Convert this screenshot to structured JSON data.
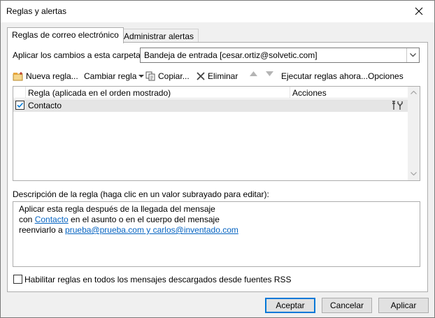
{
  "window": {
    "title": "Reglas y alertas"
  },
  "tabs": [
    {
      "label": "Reglas de correo electrónico",
      "active": true
    },
    {
      "label": "Administrar alertas",
      "active": false
    }
  ],
  "folder": {
    "label": "Aplicar los cambios a esta carpeta:",
    "value": "Bandeja de entrada [cesar.ortiz@solvetic.com]"
  },
  "toolbar": {
    "new_rule": "Nueva regla...",
    "change_rule": "Cambiar regla",
    "copy": "Copiar...",
    "delete": "Eliminar",
    "run_rules": "Ejecutar reglas ahora...",
    "options": "Opciones"
  },
  "rules_table": {
    "columns": [
      "Regla (aplicada en el orden mostrado)",
      "Acciones"
    ],
    "rows": [
      {
        "checked": true,
        "name": "Contacto",
        "action_icon": "forward-action-icon"
      }
    ]
  },
  "description": {
    "label": "Descripción de la regla (haga clic en un valor subrayado para editar):",
    "line1": "Aplicar esta regla después de la llegada del mensaje",
    "line2_prefix": "con ",
    "line2_link": "Contacto",
    "line2_suffix": " en el asunto o en el cuerpo del mensaje",
    "line3_prefix": "reenviarlo a ",
    "line3_link": "prueba@prueba.com y carlos@inventado.com"
  },
  "rss": {
    "label": "Habilitar reglas en todos los mensajes descargados desde fuentes RSS",
    "checked": false
  },
  "buttons": {
    "ok": "Aceptar",
    "cancel": "Cancelar",
    "apply": "Aplicar"
  },
  "colors": {
    "accent": "#0078d7",
    "link": "#0563c1",
    "selected_row": "#e5e5e5"
  }
}
